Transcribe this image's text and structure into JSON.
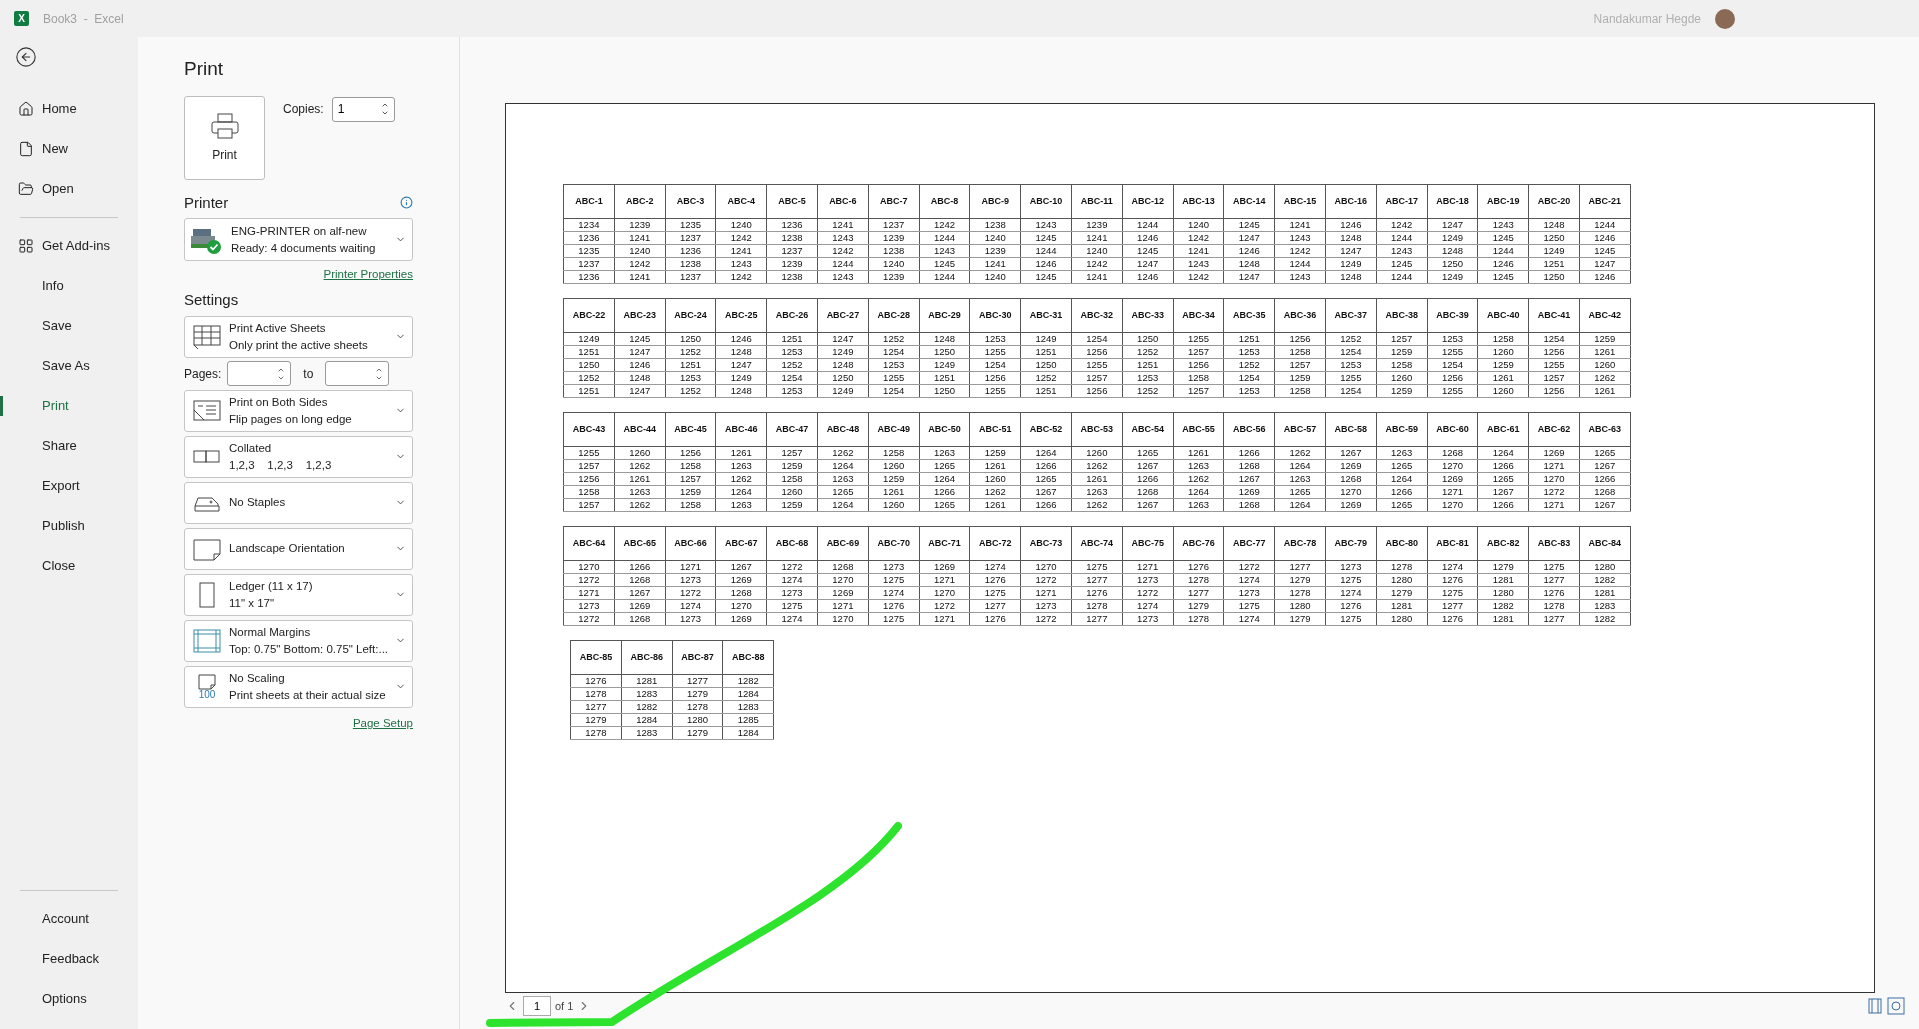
{
  "window": {
    "app_logo": "X",
    "title": "Book3  -  Excel"
  },
  "user": {
    "name": "Nandakumar Hegde"
  },
  "nav": {
    "items": [
      {
        "label": "Home",
        "selected": false
      },
      {
        "label": "New",
        "selected": false
      },
      {
        "label": "Open",
        "selected": false
      },
      {
        "label": "Get Add-ins",
        "selected": false
      },
      {
        "label": "Info",
        "selected": false
      },
      {
        "label": "Save",
        "selected": false
      },
      {
        "label": "Save As",
        "selected": false
      },
      {
        "label": "Print",
        "selected": true
      },
      {
        "label": "Share",
        "selected": false
      },
      {
        "label": "Export",
        "selected": false
      },
      {
        "label": "Publish",
        "selected": false
      },
      {
        "label": "Close",
        "selected": false
      }
    ],
    "footer": [
      {
        "label": "Account",
        "selected": false
      },
      {
        "label": "Feedback",
        "selected": false
      },
      {
        "label": "Options",
        "selected": false
      }
    ]
  },
  "print": {
    "heading": "Print",
    "print_button": "Print",
    "copies_label": "Copies:",
    "copies": "1",
    "printer_heading": "Printer",
    "printer": {
      "name": "ENG-PRINTER on alf-new",
      "status": "Ready: 4 documents waiting"
    },
    "printer_properties": "Printer Properties",
    "settings_heading": "Settings",
    "settings": [
      {
        "kind": "dropdown",
        "title": "Print Active Sheets",
        "subtitle": "Only print the active sheets"
      },
      {
        "kind": "pages",
        "label": "Pages:",
        "to": "to"
      },
      {
        "kind": "dropdown",
        "title": "Print on Both Sides",
        "subtitle": "Flip pages on long edge"
      },
      {
        "kind": "dropdown",
        "title": "Collated",
        "subtitle": "1,2,3    1,2,3    1,2,3"
      },
      {
        "kind": "dropdown",
        "title": "No Staples"
      },
      {
        "kind": "dropdown",
        "title": "Landscape Orientation"
      },
      {
        "kind": "dropdown",
        "title": "Ledger (11 x 17)",
        "subtitle": "11\" x 17\""
      },
      {
        "kind": "dropdown",
        "title": "Normal Margins",
        "subtitle": "Top: 0.75\" Bottom: 0.75\" Left:..."
      },
      {
        "kind": "dropdown",
        "badge": "100",
        "title": "No Scaling",
        "subtitle": "Print sheets at their actual size"
      }
    ],
    "page_setup": "Page Setup"
  },
  "preview": {
    "blocks": [
      {
        "headers": [
          "ABC-1",
          "ABC-2",
          "ABC-3",
          "ABC-4",
          "ABC-5",
          "ABC-6",
          "ABC-7",
          "ABC-8",
          "ABC-9",
          "ABC-10",
          "ABC-11",
          "ABC-12",
          "ABC-13",
          "ABC-14",
          "ABC-15",
          "ABC-16",
          "ABC-17",
          "ABC-18",
          "ABC-19",
          "ABC-20",
          "ABC-21"
        ],
        "rows": [
          [
            "1234",
            "1239",
            "1235",
            "1240",
            "1236",
            "1241",
            "1237",
            "1242",
            "1238",
            "1243",
            "1239",
            "1244",
            "1240",
            "1245",
            "1241",
            "1246",
            "1242",
            "1247",
            "1243",
            "1248",
            "1244"
          ],
          [
            "1236",
            "1241",
            "1237",
            "1242",
            "1238",
            "1243",
            "1239",
            "1244",
            "1240",
            "1245",
            "1241",
            "1246",
            "1242",
            "1247",
            "1243",
            "1248",
            "1244",
            "1249",
            "1245",
            "1250",
            "1246"
          ],
          [
            "1235",
            "1240",
            "1236",
            "1241",
            "1237",
            "1242",
            "1238",
            "1243",
            "1239",
            "1244",
            "1240",
            "1245",
            "1241",
            "1246",
            "1242",
            "1247",
            "1243",
            "1248",
            "1244",
            "1249",
            "1245"
          ],
          [
            "1237",
            "1242",
            "1238",
            "1243",
            "1239",
            "1244",
            "1240",
            "1245",
            "1241",
            "1246",
            "1242",
            "1247",
            "1243",
            "1248",
            "1244",
            "1249",
            "1245",
            "1250",
            "1246",
            "1251",
            "1247"
          ],
          [
            "1236",
            "1241",
            "1237",
            "1242",
            "1238",
            "1243",
            "1239",
            "1244",
            "1240",
            "1245",
            "1241",
            "1246",
            "1242",
            "1247",
            "1243",
            "1248",
            "1244",
            "1249",
            "1245",
            "1250",
            "1246"
          ]
        ]
      },
      {
        "headers": [
          "ABC-22",
          "ABC-23",
          "ABC-24",
          "ABC-25",
          "ABC-26",
          "ABC-27",
          "ABC-28",
          "ABC-29",
          "ABC-30",
          "ABC-31",
          "ABC-32",
          "ABC-33",
          "ABC-34",
          "ABC-35",
          "ABC-36",
          "ABC-37",
          "ABC-38",
          "ABC-39",
          "ABC-40",
          "ABC-41",
          "ABC-42"
        ],
        "rows": [
          [
            "1249",
            "1245",
            "1250",
            "1246",
            "1251",
            "1247",
            "1252",
            "1248",
            "1253",
            "1249",
            "1254",
            "1250",
            "1255",
            "1251",
            "1256",
            "1252",
            "1257",
            "1253",
            "1258",
            "1254",
            "1259"
          ],
          [
            "1251",
            "1247",
            "1252",
            "1248",
            "1253",
            "1249",
            "1254",
            "1250",
            "1255",
            "1251",
            "1256",
            "1252",
            "1257",
            "1253",
            "1258",
            "1254",
            "1259",
            "1255",
            "1260",
            "1256",
            "1261"
          ],
          [
            "1250",
            "1246",
            "1251",
            "1247",
            "1252",
            "1248",
            "1253",
            "1249",
            "1254",
            "1250",
            "1255",
            "1251",
            "1256",
            "1252",
            "1257",
            "1253",
            "1258",
            "1254",
            "1259",
            "1255",
            "1260"
          ],
          [
            "1252",
            "1248",
            "1253",
            "1249",
            "1254",
            "1250",
            "1255",
            "1251",
            "1256",
            "1252",
            "1257",
            "1253",
            "1258",
            "1254",
            "1259",
            "1255",
            "1260",
            "1256",
            "1261",
            "1257",
            "1262"
          ],
          [
            "1251",
            "1247",
            "1252",
            "1248",
            "1253",
            "1249",
            "1254",
            "1250",
            "1255",
            "1251",
            "1256",
            "1252",
            "1257",
            "1253",
            "1258",
            "1254",
            "1259",
            "1255",
            "1260",
            "1256",
            "1261"
          ]
        ]
      },
      {
        "headers": [
          "ABC-43",
          "ABC-44",
          "ABC-45",
          "ABC-46",
          "ABC-47",
          "ABC-48",
          "ABC-49",
          "ABC-50",
          "ABC-51",
          "ABC-52",
          "ABC-53",
          "ABC-54",
          "ABC-55",
          "ABC-56",
          "ABC-57",
          "ABC-58",
          "ABC-59",
          "ABC-60",
          "ABC-61",
          "ABC-62",
          "ABC-63"
        ],
        "rows": [
          [
            "1255",
            "1260",
            "1256",
            "1261",
            "1257",
            "1262",
            "1258",
            "1263",
            "1259",
            "1264",
            "1260",
            "1265",
            "1261",
            "1266",
            "1262",
            "1267",
            "1263",
            "1268",
            "1264",
            "1269",
            "1265"
          ],
          [
            "1257",
            "1262",
            "1258",
            "1263",
            "1259",
            "1264",
            "1260",
            "1265",
            "1261",
            "1266",
            "1262",
            "1267",
            "1263",
            "1268",
            "1264",
            "1269",
            "1265",
            "1270",
            "1266",
            "1271",
            "1267"
          ],
          [
            "1256",
            "1261",
            "1257",
            "1262",
            "1258",
            "1263",
            "1259",
            "1264",
            "1260",
            "1265",
            "1261",
            "1266",
            "1262",
            "1267",
            "1263",
            "1268",
            "1264",
            "1269",
            "1265",
            "1270",
            "1266"
          ],
          [
            "1258",
            "1263",
            "1259",
            "1264",
            "1260",
            "1265",
            "1261",
            "1266",
            "1262",
            "1267",
            "1263",
            "1268",
            "1264",
            "1269",
            "1265",
            "1270",
            "1266",
            "1271",
            "1267",
            "1272",
            "1268"
          ],
          [
            "1257",
            "1262",
            "1258",
            "1263",
            "1259",
            "1264",
            "1260",
            "1265",
            "1261",
            "1266",
            "1262",
            "1267",
            "1263",
            "1268",
            "1264",
            "1269",
            "1265",
            "1270",
            "1266",
            "1271",
            "1267"
          ]
        ]
      },
      {
        "headers": [
          "ABC-64",
          "ABC-65",
          "ABC-66",
          "ABC-67",
          "ABC-68",
          "ABC-69",
          "ABC-70",
          "ABC-71",
          "ABC-72",
          "ABC-73",
          "ABC-74",
          "ABC-75",
          "ABC-76",
          "ABC-77",
          "ABC-78",
          "ABC-79",
          "ABC-80",
          "ABC-81",
          "ABC-82",
          "ABC-83",
          "ABC-84"
        ],
        "rows": [
          [
            "1270",
            "1266",
            "1271",
            "1267",
            "1272",
            "1268",
            "1273",
            "1269",
            "1274",
            "1270",
            "1275",
            "1271",
            "1276",
            "1272",
            "1277",
            "1273",
            "1278",
            "1274",
            "1279",
            "1275",
            "1280"
          ],
          [
            "1272",
            "1268",
            "1273",
            "1269",
            "1274",
            "1270",
            "1275",
            "1271",
            "1276",
            "1272",
            "1277",
            "1273",
            "1278",
            "1274",
            "1279",
            "1275",
            "1280",
            "1276",
            "1281",
            "1277",
            "1282"
          ],
          [
            "1271",
            "1267",
            "1272",
            "1268",
            "1273",
            "1269",
            "1274",
            "1270",
            "1275",
            "1271",
            "1276",
            "1272",
            "1277",
            "1273",
            "1278",
            "1274",
            "1279",
            "1275",
            "1280",
            "1276",
            "1281"
          ],
          [
            "1273",
            "1269",
            "1274",
            "1270",
            "1275",
            "1271",
            "1276",
            "1272",
            "1277",
            "1273",
            "1278",
            "1274",
            "1279",
            "1275",
            "1280",
            "1276",
            "1281",
            "1277",
            "1282",
            "1278",
            "1283"
          ],
          [
            "1272",
            "1268",
            "1273",
            "1269",
            "1274",
            "1270",
            "1275",
            "1271",
            "1276",
            "1272",
            "1277",
            "1273",
            "1278",
            "1274",
            "1279",
            "1275",
            "1280",
            "1276",
            "1281",
            "1277",
            "1282"
          ]
        ]
      },
      {
        "headers": [
          "ABC-85",
          "ABC-86",
          "ABC-87",
          "ABC-88"
        ],
        "rows": [
          [
            "1276",
            "1281",
            "1277",
            "1282"
          ],
          [
            "1278",
            "1283",
            "1279",
            "1284"
          ],
          [
            "1277",
            "1282",
            "1278",
            "1283"
          ],
          [
            "1279",
            "1284",
            "1280",
            "1285"
          ],
          [
            "1278",
            "1283",
            "1279",
            "1284"
          ]
        ]
      }
    ],
    "page_nav": {
      "current": "1",
      "of": "of 1"
    }
  }
}
